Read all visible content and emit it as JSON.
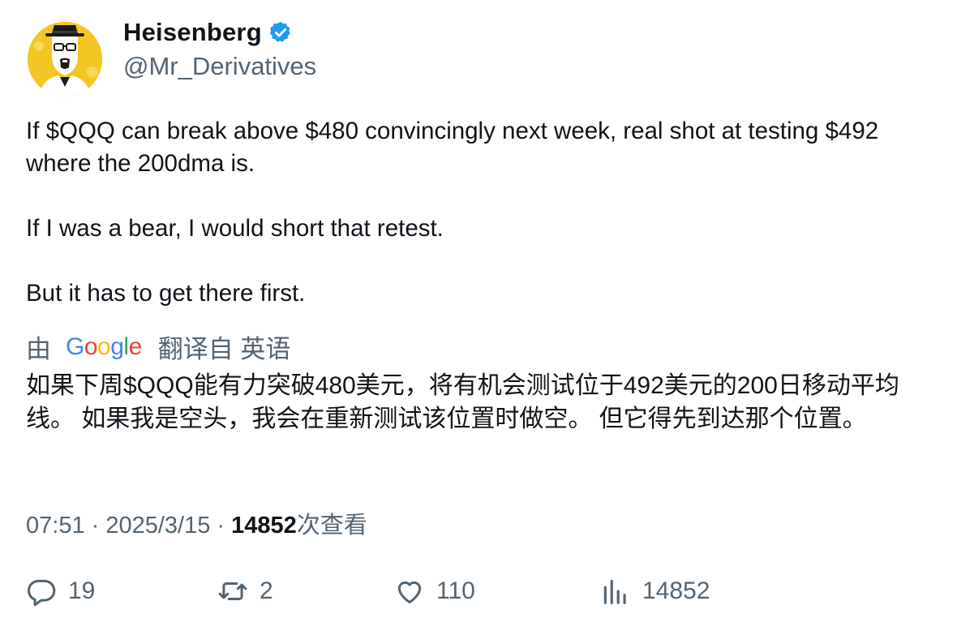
{
  "author": {
    "display_name": "Heisenberg",
    "handle": "@Mr_Derivatives",
    "verified": true,
    "avatar_icon": "heisenberg-avatar"
  },
  "tweet": {
    "paragraphs": [
      "If $QQQ can break above $480 convincingly next week, real shot at testing $492 where the 200dma is.",
      "If I was a bear, I would short that retest.",
      "But it has to get there first."
    ]
  },
  "translation": {
    "by_label": "由",
    "provider": "Google",
    "from_label": "翻译自 英语",
    "text": "如果下周$QQQ能有力突破480美元，将有机会测试位于492美元的200日移动平均线。 如果我是空头，我会在重新测试该位置时做空。 但它得先到达那个位置。"
  },
  "meta": {
    "time": "07:51",
    "sep1": " · ",
    "date": "2025/3/15",
    "sep2": " · ",
    "views_count": "14852",
    "views_label": "次查看"
  },
  "actions": {
    "replies": "19",
    "retweets": "2",
    "likes": "110",
    "views": "14852"
  },
  "colors": {
    "verified_blue": "#1d9bf0",
    "secondary_text": "#536471",
    "avatar_bg": "#f3c623"
  }
}
